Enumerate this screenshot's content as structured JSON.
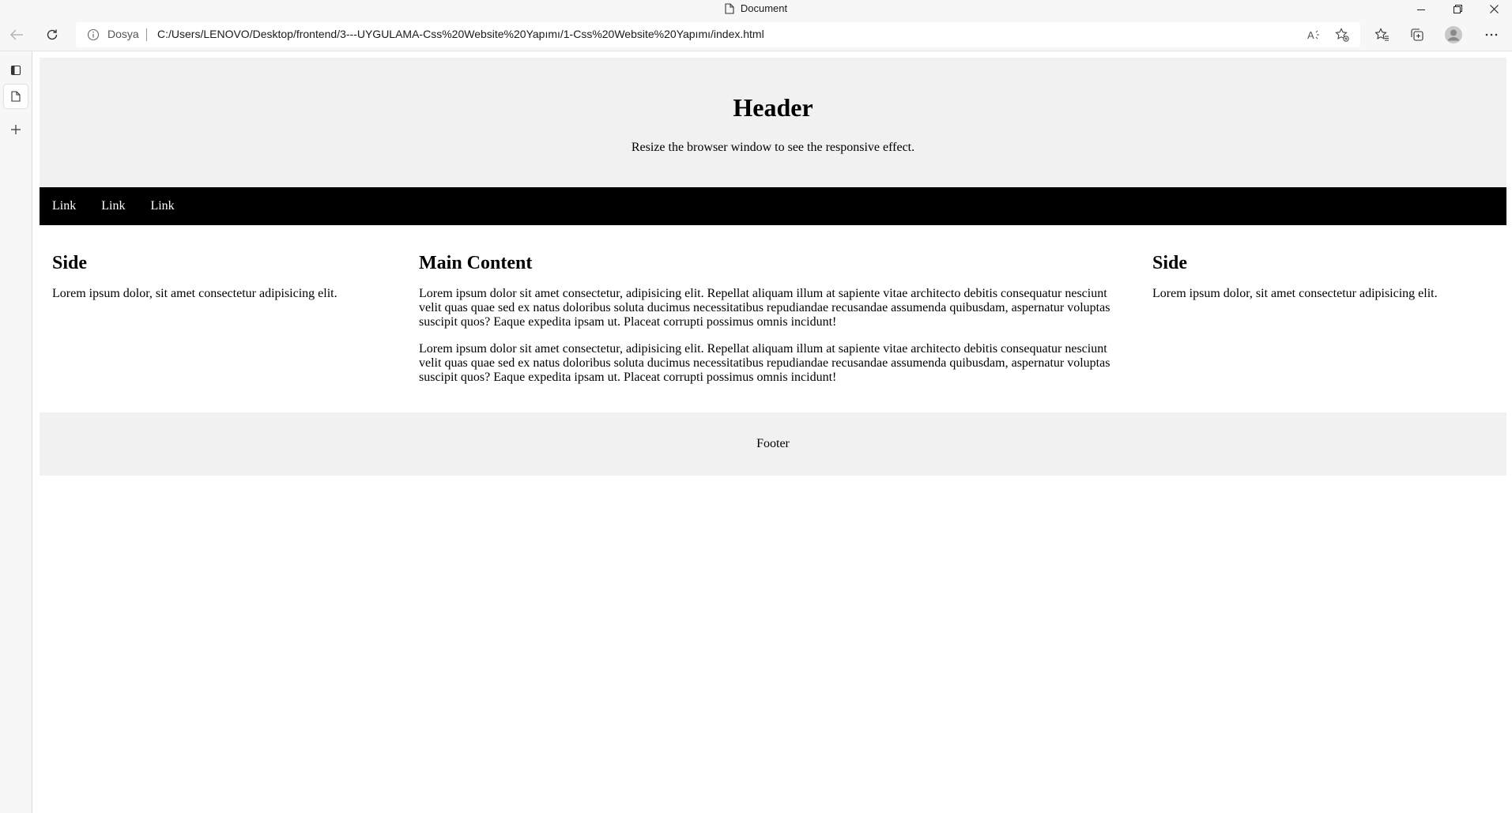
{
  "window": {
    "title": "Document"
  },
  "toolbar": {
    "site_info_label": "Dosya",
    "url": "C:/Users/LENOVO/Desktop/frontend/3---UYGULAMA-Css%20Website%20Yapımı/1-Css%20Website%20Yapımı/index.html"
  },
  "page": {
    "header": {
      "title": "Header",
      "subtitle": "Resize the browser window to see the responsive effect."
    },
    "nav": {
      "links": [
        "Link",
        "Link",
        "Link"
      ]
    },
    "left_side": {
      "title": "Side",
      "text": "Lorem ipsum dolor, sit amet consectetur adipisicing elit."
    },
    "main": {
      "title": "Main Content",
      "paragraphs": [
        "Lorem ipsum dolor sit amet consectetur, adipisicing elit. Repellat aliquam illum at sapiente vitae architecto debitis consequatur nesciunt velit quas quae sed ex natus doloribus soluta ducimus necessitatibus repudiandae recusandae assumenda quibusdam, aspernatur voluptas suscipit quos? Eaque expedita ipsam ut. Placeat corrupti possimus omnis incidunt!",
        "Lorem ipsum dolor sit amet consectetur, adipisicing elit. Repellat aliquam illum at sapiente vitae architecto debitis consequatur nesciunt velit quas quae sed ex natus doloribus soluta ducimus necessitatibus repudiandae recusandae assumenda quibusdam, aspernatur voluptas suscipit quos? Eaque expedita ipsam ut. Placeat corrupti possimus omnis incidunt!"
      ]
    },
    "right_side": {
      "title": "Side",
      "text": "Lorem ipsum dolor, sit amet consectetur adipisicing elit."
    },
    "footer": {
      "text": "Footer"
    }
  },
  "icons": {
    "title_doc": "document-icon",
    "minimize": "minimize-icon",
    "restore": "restore-icon",
    "close": "close-icon",
    "back": "back-arrow-icon",
    "refresh": "refresh-icon",
    "info": "info-icon",
    "read_aloud": "read-aloud-icon",
    "add_favorite": "add-favorite-icon",
    "favorites": "favorites-icon",
    "collections": "collections-icon",
    "profile": "profile-avatar-icon",
    "more": "more-icon",
    "tab_actions": "tab-actions-icon",
    "tab": "tab-page-icon",
    "new_tab": "new-tab-icon"
  }
}
